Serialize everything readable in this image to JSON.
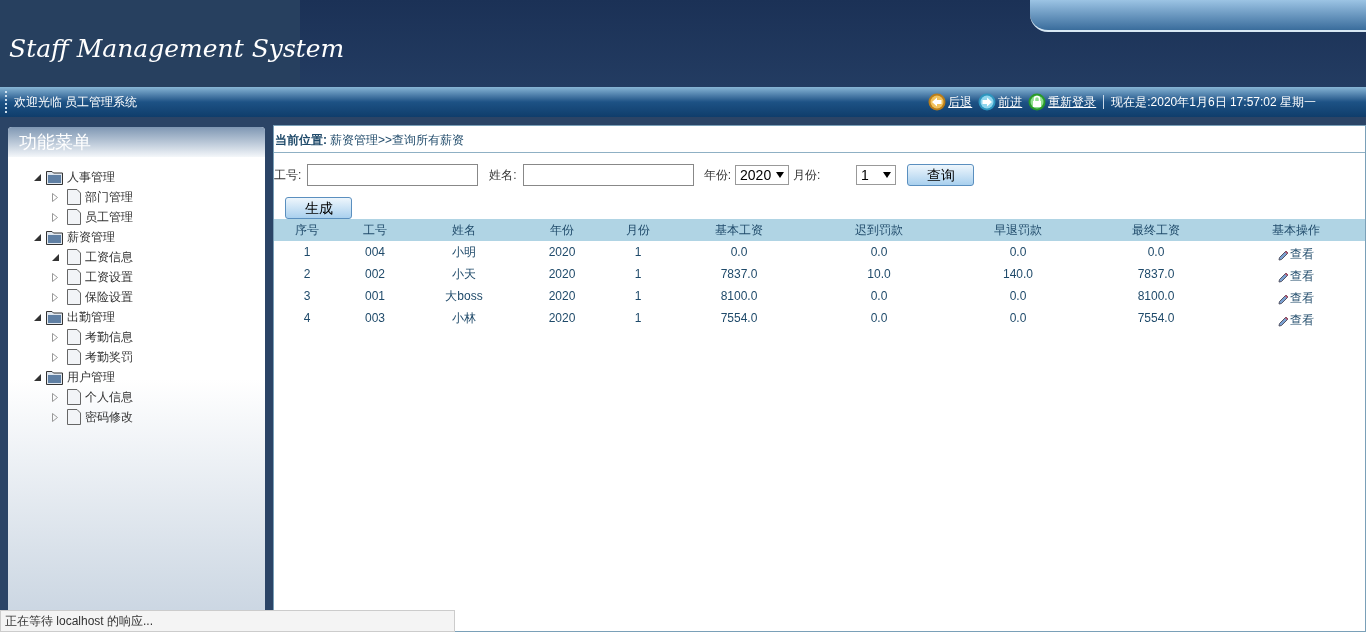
{
  "header": {
    "logo": "Staff Management System"
  },
  "nav_bar": {
    "welcome": "欢迎光临 员工管理系统",
    "links": [
      {
        "kind": "back",
        "label": "后退"
      },
      {
        "kind": "forward",
        "label": "前进"
      },
      {
        "kind": "relogin",
        "label": "重新登录"
      }
    ],
    "clock": "现在是:2020年1月6日 17:57:02 星期一"
  },
  "sidebar": {
    "title": "功能菜单",
    "items": [
      {
        "label": "人事管理",
        "expanded": true,
        "children": [
          {
            "label": "部门管理",
            "expanded": false
          },
          {
            "label": "员工管理",
            "expanded": false
          }
        ]
      },
      {
        "label": "薪资管理",
        "expanded": true,
        "children": [
          {
            "label": "工资信息",
            "expanded": true
          },
          {
            "label": "工资设置",
            "expanded": false
          },
          {
            "label": "保险设置",
            "expanded": false
          }
        ]
      },
      {
        "label": "出勤管理",
        "expanded": true,
        "children": [
          {
            "label": "考勤信息",
            "expanded": false
          },
          {
            "label": "考勤奖罚",
            "expanded": false
          }
        ]
      },
      {
        "label": "用户管理",
        "expanded": true,
        "children": [
          {
            "label": "个人信息",
            "expanded": false
          },
          {
            "label": "密码修改",
            "expanded": false
          }
        ]
      }
    ]
  },
  "breadcrumb": {
    "label": "当前位置:",
    "path": "薪资管理>>查询所有薪资"
  },
  "filters": {
    "id_label": "工号:",
    "name_label": "姓名:",
    "year_label": "年份:",
    "year": "2020",
    "month_label": "月份:",
    "month": "1",
    "search_button": "查询"
  },
  "generate_button": "生成",
  "table": {
    "columns": [
      "序号",
      "工号",
      "姓名",
      "年份",
      "月份",
      "基本工资",
      "迟到罚款",
      "早退罚款",
      "最终工资",
      "基本操作"
    ],
    "rows": [
      [
        "1",
        "004",
        "小明",
        "2020",
        "1",
        "0.0",
        "0.0",
        "0.0",
        "0.0",
        "查看"
      ],
      [
        "2",
        "002",
        "小天",
        "2020",
        "1",
        "7837.0",
        "10.0",
        "140.0",
        "7837.0",
        "查看"
      ],
      [
        "3",
        "001",
        "大boss",
        "2020",
        "1",
        "8100.0",
        "0.0",
        "0.0",
        "8100.0",
        "查看"
      ],
      [
        "4",
        "003",
        "小林",
        "2020",
        "1",
        "7554.0",
        "0.0",
        "0.0",
        "7554.0",
        "查看"
      ]
    ]
  },
  "status_bar": "正在等待 localhost 的响应..."
}
